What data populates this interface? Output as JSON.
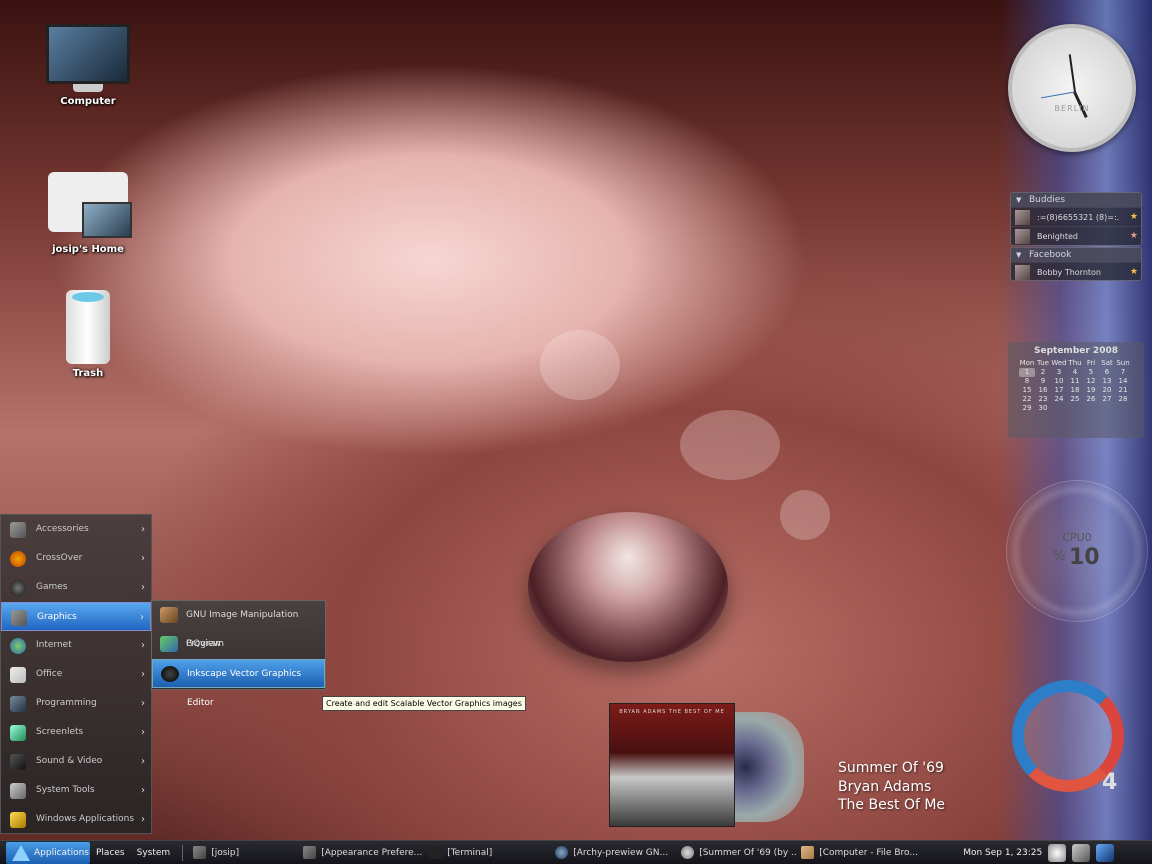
{
  "desktop": {
    "icons": [
      {
        "label": "Computer"
      },
      {
        "label": "josip's Home"
      },
      {
        "label": "Trash"
      }
    ]
  },
  "clock": {
    "city": "BERLIN"
  },
  "buddies": {
    "title": "Buddies",
    "items": [
      {
        "name": ":=(8)6655321 (8)=:."
      },
      {
        "name": "Benighted"
      }
    ]
  },
  "facebook": {
    "title": "Facebook",
    "items": [
      {
        "name": "Bobby Thornton"
      }
    ]
  },
  "calendar": {
    "title": "September 2008",
    "weekdays": [
      "Mon",
      "Tue",
      "Wed",
      "Thu",
      "Fri",
      "Sat",
      "Sun"
    ],
    "days": [
      "1",
      "2",
      "3",
      "4",
      "5",
      "6",
      "7",
      "8",
      "9",
      "10",
      "11",
      "12",
      "13",
      "14",
      "15",
      "16",
      "17",
      "18",
      "19",
      "20",
      "21",
      "22",
      "23",
      "24",
      "25",
      "26",
      "27",
      "28",
      "29",
      "30"
    ]
  },
  "cpu": {
    "label": "CPU0",
    "percent_sign": "%",
    "value": "10"
  },
  "logo_counter": "4",
  "now_playing": {
    "song": "Summer Of '69",
    "artist": "Bryan Adams",
    "album": "The Best Of Me",
    "album_cover_text": "BRYAN ADAMS THE BEST OF ME"
  },
  "apps_menu": {
    "items": [
      {
        "label": "Accessories",
        "icon": "accessories-icon"
      },
      {
        "label": "CrossOver",
        "icon": "crossover-icon"
      },
      {
        "label": "Games",
        "icon": "games-icon"
      },
      {
        "label": "Graphics",
        "icon": "graphics-icon",
        "active": true
      },
      {
        "label": "Internet",
        "icon": "internet-icon"
      },
      {
        "label": "Office",
        "icon": "office-icon"
      },
      {
        "label": "Programming",
        "icon": "programming-icon"
      },
      {
        "label": "Screenlets",
        "icon": "screenlets-icon"
      },
      {
        "label": "Sound & Video",
        "icon": "sound-video-icon"
      },
      {
        "label": "System Tools",
        "icon": "system-tools-icon"
      },
      {
        "label": "Windows Applications",
        "icon": "windows-apps-icon"
      }
    ],
    "graphics_submenu": [
      {
        "label": "GNU Image Manipulation Program"
      },
      {
        "label": "GQview"
      },
      {
        "label": "Inkscape Vector Graphics Editor"
      }
    ],
    "tooltip": "Create and edit Scalable Vector Graphics images"
  },
  "taskbar": {
    "applications": "Applications",
    "places": "Places",
    "system": "System",
    "tasks": [
      {
        "label": "[josip]"
      },
      {
        "label": "[Appearance Prefere..."
      },
      {
        "label": "[Terminal]"
      },
      {
        "label": "[Archy-prewiew GN..."
      },
      {
        "label": "[Summer Of '69 (by ..."
      },
      {
        "label": "[Computer - File Bro..."
      }
    ],
    "datetime": "Mon Sep  1, 23:25"
  }
}
